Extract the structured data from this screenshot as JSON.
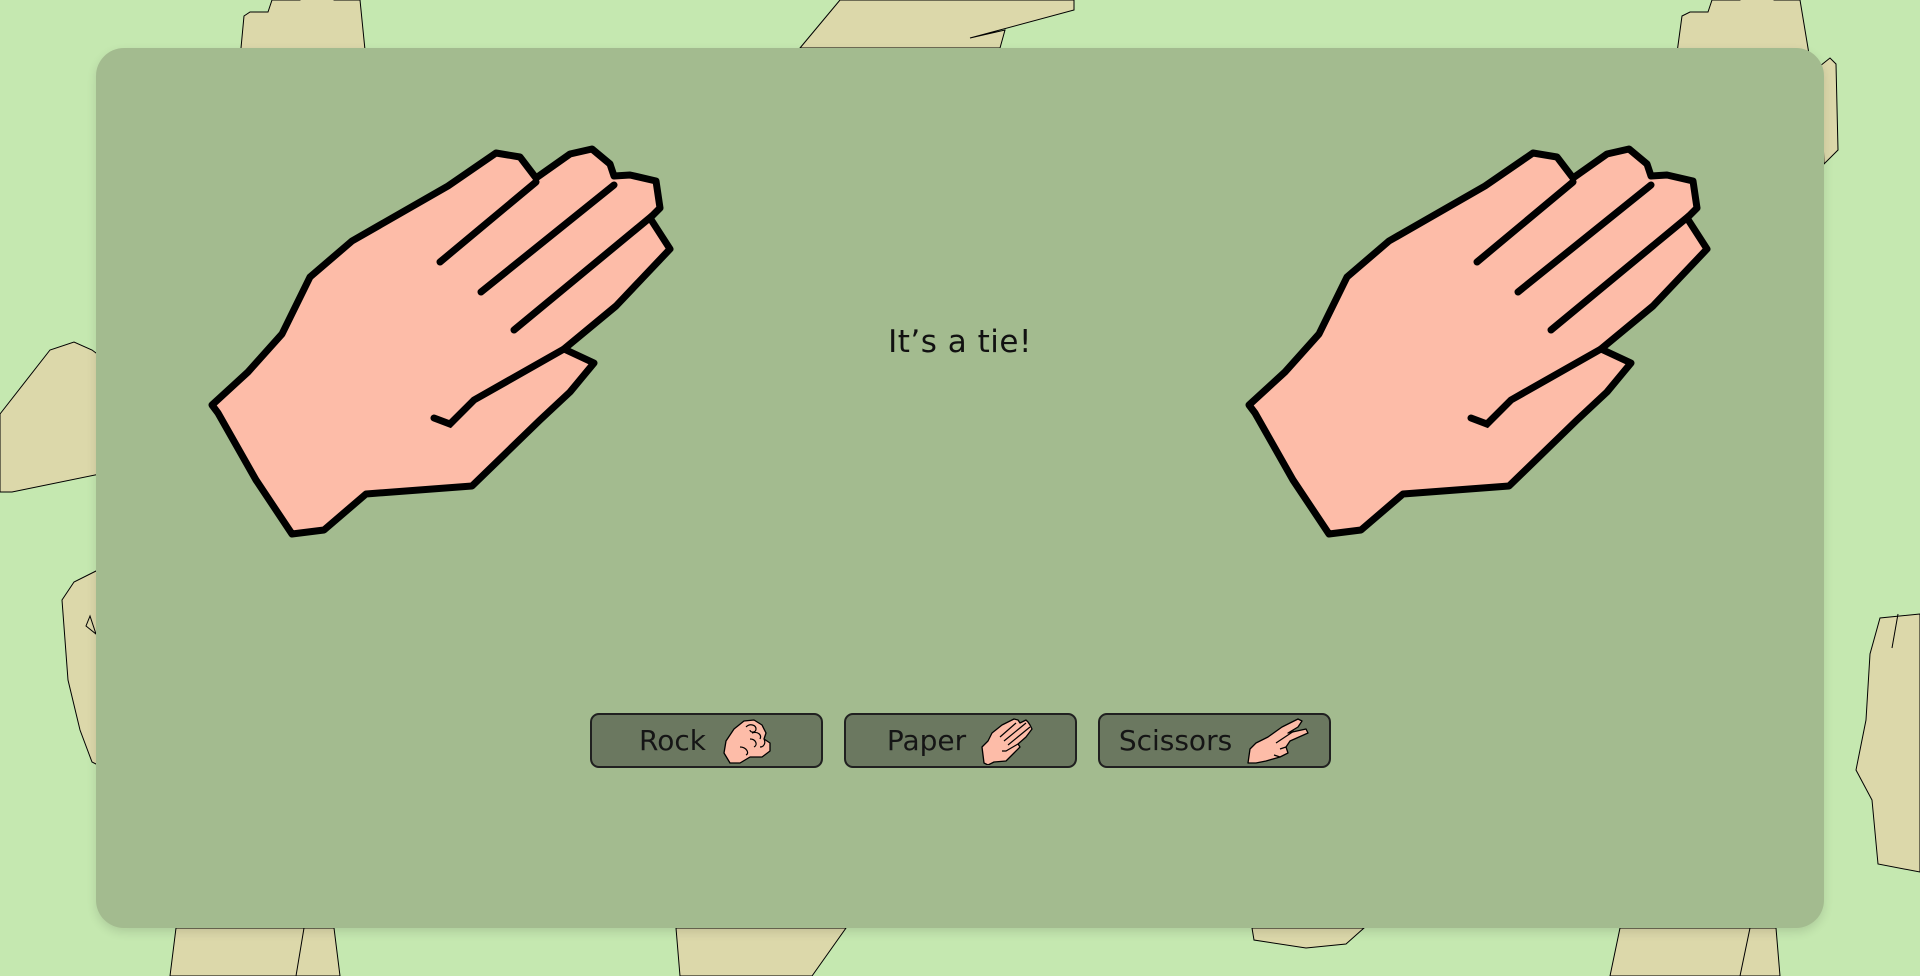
{
  "colors": {
    "page_background": "#c5e8b0",
    "card_background": "#a3bb8f",
    "button_background": "#6b7860",
    "hand_skin": "#fdbca8",
    "hand_outline": "#000000",
    "background_hand": "#dcd8aa"
  },
  "game": {
    "player_hand_icon": "paper-hand-icon",
    "computer_hand_icon": "paper-hand-icon",
    "result_text": "It’s a tie!"
  },
  "choices": [
    {
      "label": "Rock",
      "icon": "rock-fist-icon"
    },
    {
      "label": "Paper",
      "icon": "paper-hand-icon"
    },
    {
      "label": "Scissors",
      "icon": "scissors-fingers-icon"
    }
  ]
}
